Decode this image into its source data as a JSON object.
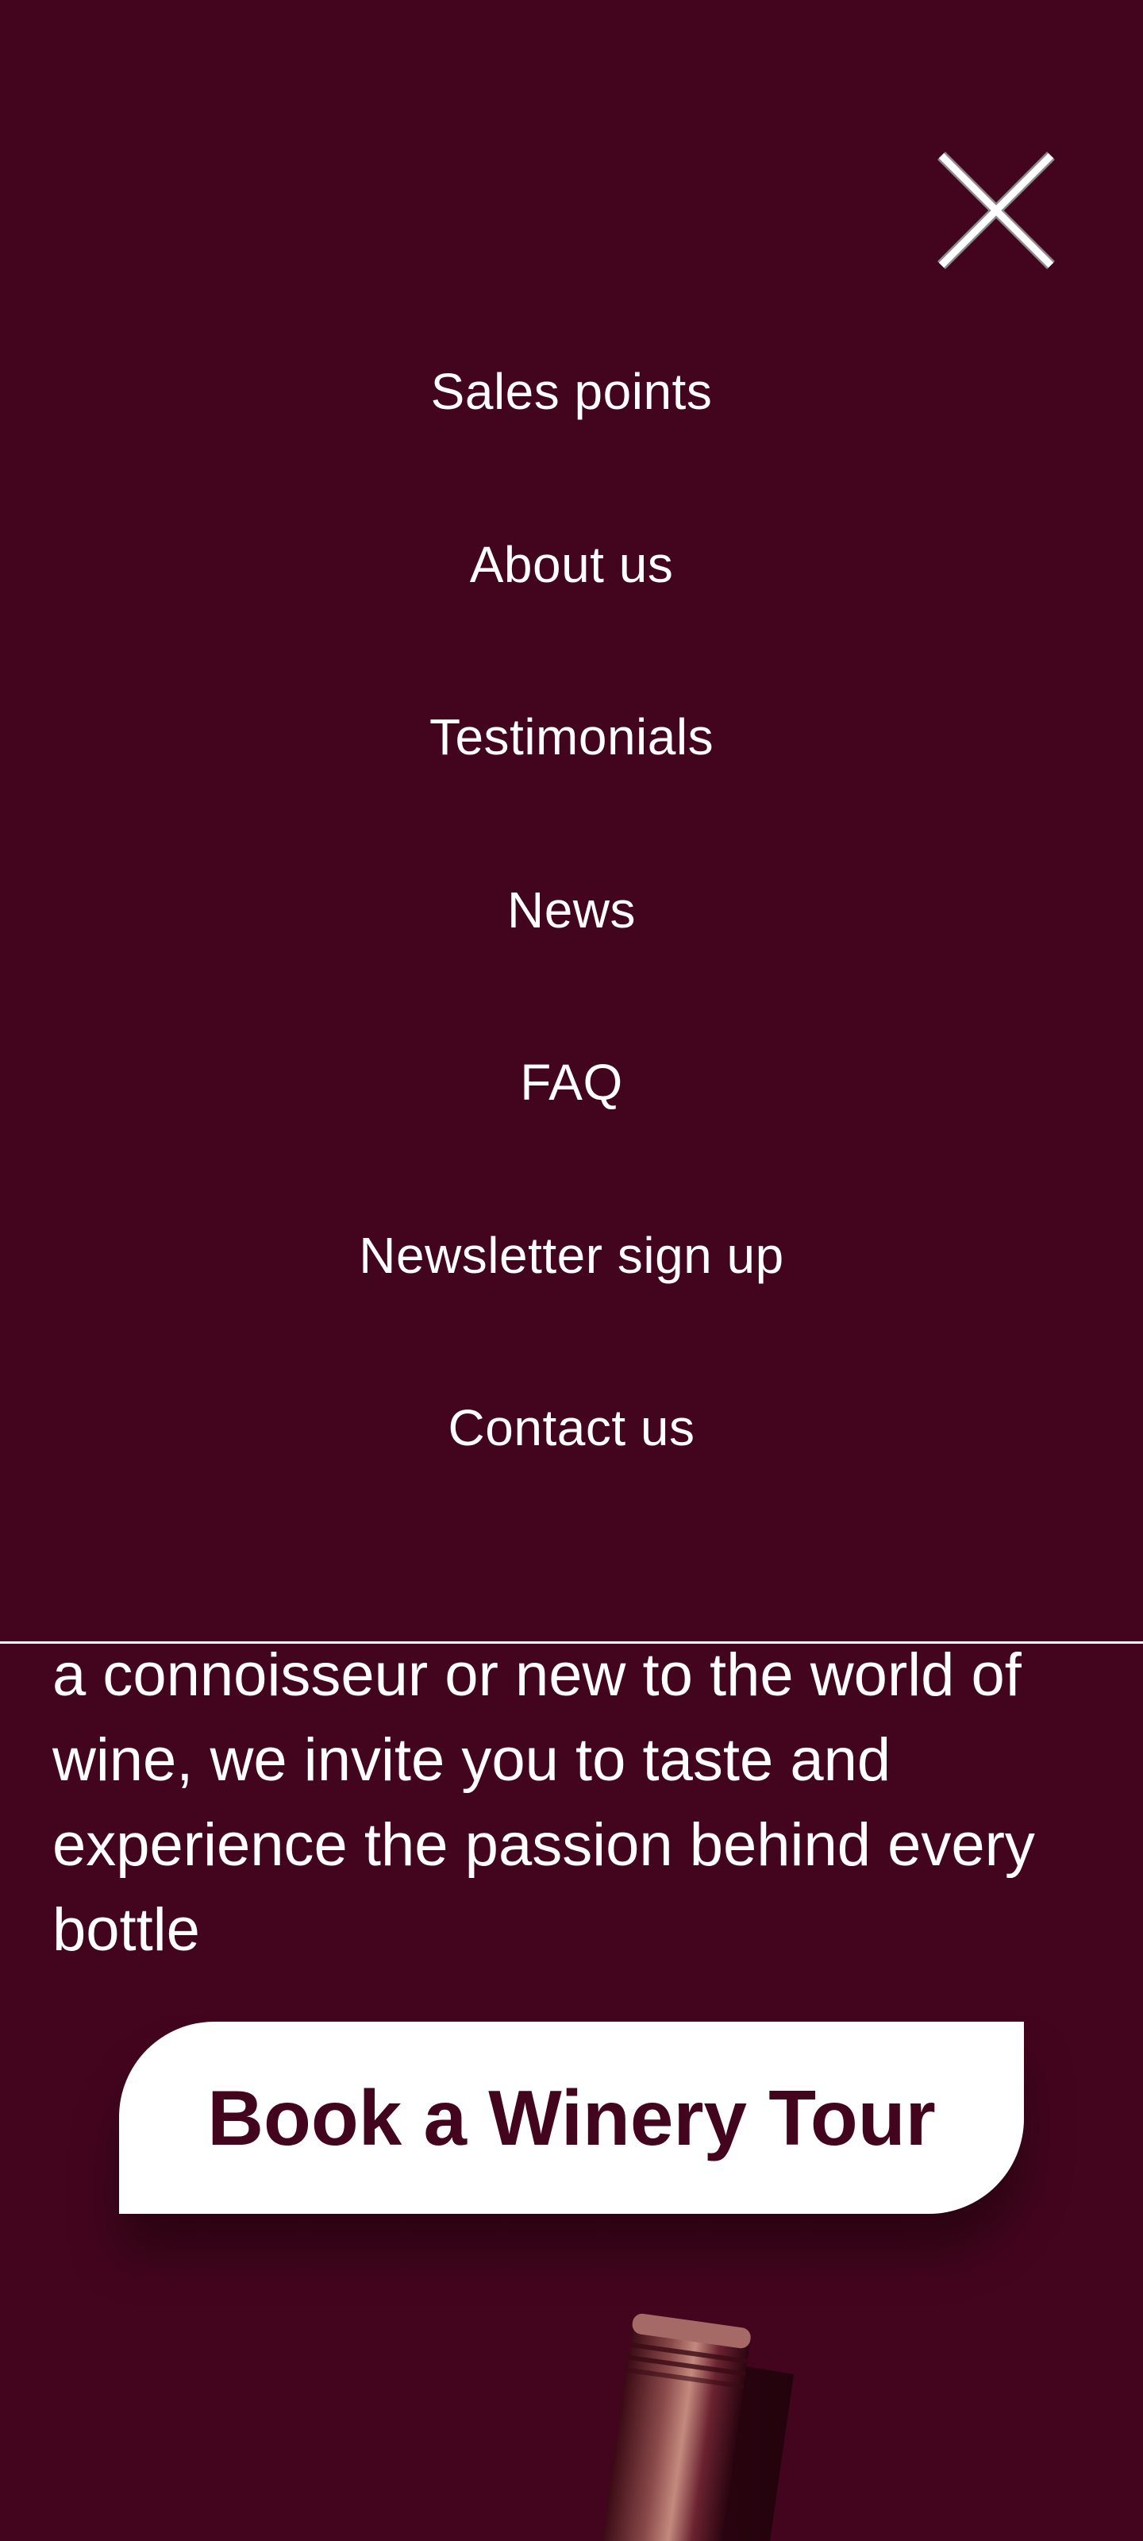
{
  "menu": {
    "close_icon": "close-icon",
    "items": [
      {
        "label": "Sales points"
      },
      {
        "label": "About us"
      },
      {
        "label": "Testimonials"
      },
      {
        "label": "News"
      },
      {
        "label": "FAQ"
      },
      {
        "label": "Newsletter sign up"
      },
      {
        "label": "Contact us"
      }
    ]
  },
  "hero": {
    "intro_line_1": "a connoisseur or new to the world of",
    "intro_line_2": "wine, we invite you to taste and",
    "intro_line_3": "experience the passion behind every",
    "intro_line_4": "bottle",
    "cta_label": "Book a Winery Tour"
  },
  "colors": {
    "background": "#43051d",
    "text": "#ffffff",
    "button_bg": "#ffffff",
    "button_text": "#43051d"
  }
}
